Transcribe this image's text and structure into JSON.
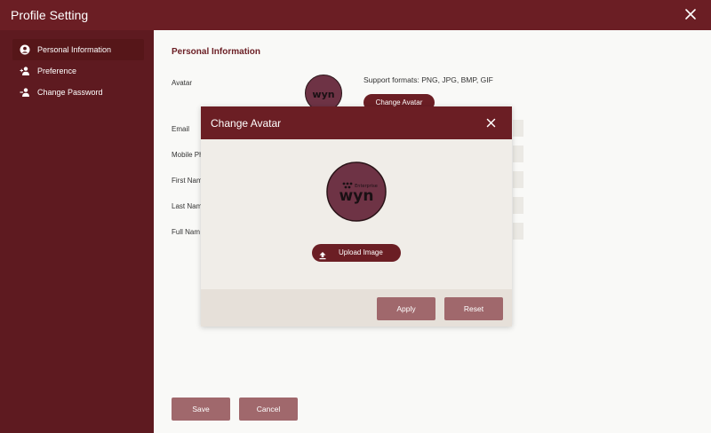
{
  "window": {
    "title": "Profile Setting"
  },
  "sidebar": {
    "items": [
      {
        "label": "Personal Information",
        "icon": "user-circle-icon",
        "active": true
      },
      {
        "label": "Preference",
        "icon": "user-plus-icon",
        "active": false
      },
      {
        "label": "Change Password",
        "icon": "user-key-icon",
        "active": false
      }
    ]
  },
  "content": {
    "section_title": "Personal Information",
    "avatar_label": "Avatar",
    "support_formats": "Support formats: PNG, JPG, BMP, GIF",
    "change_avatar_label": "Change Avatar",
    "fields": [
      {
        "label": "Email"
      },
      {
        "label": "Mobile Ph"
      },
      {
        "label": "First Nam"
      },
      {
        "label": "Last Nam"
      },
      {
        "label": "Full Nam"
      }
    ],
    "save_label": "Save",
    "cancel_label": "Cancel"
  },
  "avatar_logo": {
    "brand": "wyn",
    "sub": "Enterprise"
  },
  "modal": {
    "title": "Change Avatar",
    "upload_label": "Upload Image",
    "apply_label": "Apply",
    "reset_label": "Reset"
  },
  "colors": {
    "titlebar": "#6b1e24",
    "sidebar": "#5e1a20",
    "button_primary": "#6b1e24",
    "button_muted": "#a0686c",
    "avatar_fill": "#6e3345"
  }
}
